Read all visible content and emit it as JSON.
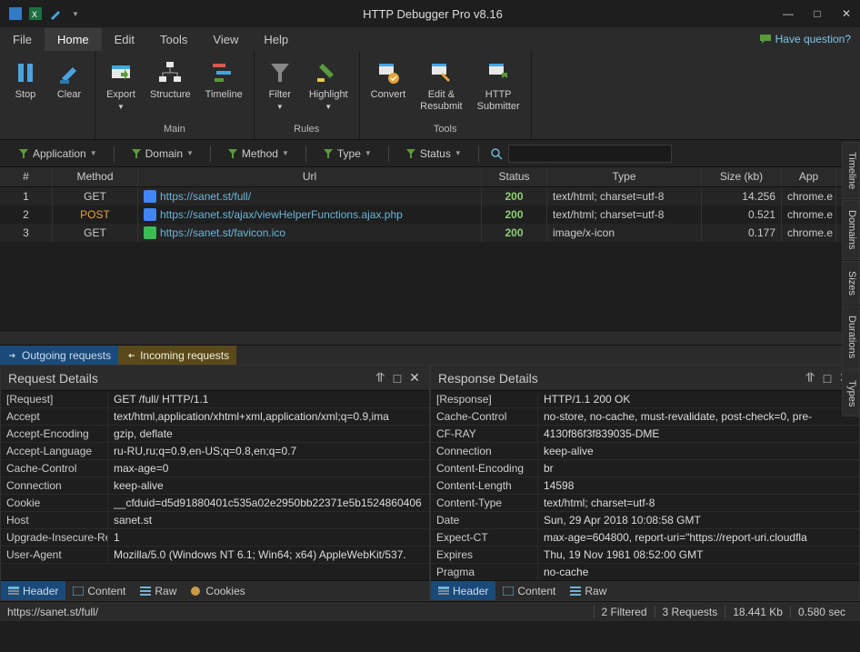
{
  "title": "HTTP Debugger Pro v8.16",
  "have_question": "Have question?",
  "menu": [
    "File",
    "Home",
    "Edit",
    "Tools",
    "View",
    "Help"
  ],
  "menu_active": 1,
  "ribbon": {
    "stop": "Stop",
    "clear": "Clear",
    "export": "Export",
    "structure": "Structure",
    "timeline": "Timeline",
    "filter": "Filter",
    "highlight": "Highlight",
    "convert": "Convert",
    "edit_resubmit": "Edit &\nResubmit",
    "http_submitter": "HTTP\nSubmitter",
    "main": "Main",
    "rules": "Rules",
    "tools": "Tools"
  },
  "filterbar": {
    "application": "Application",
    "domain": "Domain",
    "method": "Method",
    "type": "Type",
    "status": "Status"
  },
  "grid": {
    "cols": {
      "num": "#",
      "method": "Method",
      "url": "Url",
      "status": "Status",
      "type": "Type",
      "size": "Size (kb)",
      "app": "App"
    },
    "rows": [
      {
        "n": "1",
        "m": "GET",
        "u": "https://sanet.st/full/",
        "s": "200",
        "t": "text/html; charset=utf-8",
        "sz": "14.256",
        "a": "chrome.e"
      },
      {
        "n": "2",
        "m": "POST",
        "u": "https://sanet.st/ajax/viewHelperFunctions.ajax.php",
        "s": "200",
        "t": "text/html; charset=utf-8",
        "sz": "0.521",
        "a": "chrome.e"
      },
      {
        "n": "3",
        "m": "GET",
        "u": "https://sanet.st/favicon.ico",
        "s": "200",
        "t": "image/x-icon",
        "sz": "0.177",
        "a": "chrome.e"
      }
    ]
  },
  "tabs": {
    "outgoing": "Outgoing requests",
    "incoming": "Incoming requests"
  },
  "req": {
    "title": "Request Details",
    "rows": [
      [
        "[Request]",
        "GET /full/ HTTP/1.1"
      ],
      [
        "Accept",
        "text/html,application/xhtml+xml,application/xml;q=0.9,ima"
      ],
      [
        "Accept-Encoding",
        "gzip, deflate"
      ],
      [
        "Accept-Language",
        "ru-RU,ru;q=0.9,en-US;q=0.8,en;q=0.7"
      ],
      [
        "Cache-Control",
        "max-age=0"
      ],
      [
        "Connection",
        "keep-alive"
      ],
      [
        "Cookie",
        "__cfduid=d5d91880401c535a02e2950bb22371e5b1524860406"
      ],
      [
        "Host",
        "sanet.st"
      ],
      [
        "Upgrade-Insecure-Req",
        "1"
      ],
      [
        "User-Agent",
        "Mozilla/5.0 (Windows NT 6.1; Win64; x64) AppleWebKit/537."
      ]
    ],
    "tabs": [
      "Header",
      "Content",
      "Raw",
      "Cookies"
    ]
  },
  "res": {
    "title": "Response Details",
    "rows": [
      [
        "[Response]",
        "HTTP/1.1 200 OK"
      ],
      [
        "Cache-Control",
        "no-store, no-cache, must-revalidate, post-check=0, pre-"
      ],
      [
        "CF-RAY",
        "4130f86f3f839035-DME"
      ],
      [
        "Connection",
        "keep-alive"
      ],
      [
        "Content-Encoding",
        "br"
      ],
      [
        "Content-Length",
        "14598"
      ],
      [
        "Content-Type",
        "text/html; charset=utf-8"
      ],
      [
        "Date",
        "Sun, 29 Apr 2018 10:08:58 GMT"
      ],
      [
        "Expect-CT",
        "max-age=604800, report-uri=\"https://report-uri.cloudfla"
      ],
      [
        "Expires",
        "Thu, 19 Nov 1981 08:52:00 GMT"
      ],
      [
        "Pragma",
        "no-cache"
      ]
    ],
    "tabs": [
      "Header",
      "Content",
      "Raw"
    ]
  },
  "status": {
    "url": "https://sanet.st/full/",
    "filtered": "2 Filtered",
    "requests": "3 Requests",
    "size": "18.441 Kb",
    "time": "0.580 sec"
  },
  "sidetabs": [
    "Timeline",
    "Domains",
    "Sizes",
    "Durations",
    "Types"
  ]
}
